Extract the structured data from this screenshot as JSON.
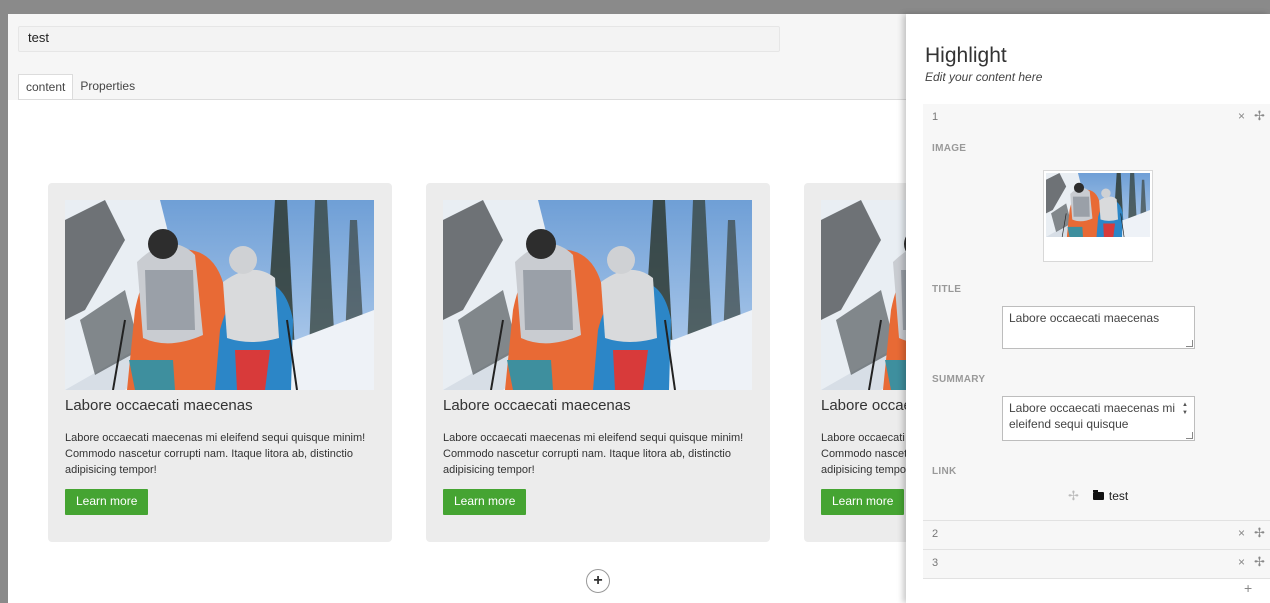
{
  "editor": {
    "name_value": "test",
    "tabs": [
      {
        "label": "content"
      },
      {
        "label": "Properties"
      }
    ]
  },
  "cards": [
    {
      "title": "Labore occaecati maecenas",
      "text": "Labore occaecati maecenas mi eleifend sequi quisque minim! Commodo nascetur corrupti nam. Itaque litora ab, distinctio adipisicing tempor!",
      "button": "Learn more"
    },
    {
      "title": "Labore occaecati maecenas",
      "text": "Labore occaecati maecenas mi eleifend sequi quisque minim! Commodo nascetur corrupti nam. Itaque litora ab, distinctio adipisicing tempor!",
      "button": "Learn more"
    },
    {
      "title": "Labore occaecati maecenas",
      "text": "Labore occaecati maecenas mi eleifend sequi quisque minim! Commodo nascetur corrupti nam. Itaque litora ab, distinctio adipisicing tempor!",
      "button": "Learn more"
    }
  ],
  "add_section_icon": "plus-circle-icon",
  "panel": {
    "title": "Highlight",
    "subtitle": "Edit your content here",
    "items": [
      {
        "number": "1"
      },
      {
        "number": "2"
      },
      {
        "number": "3"
      }
    ],
    "remove_glyph": "×",
    "move_glyph": "✢",
    "add_glyph": "+",
    "fields": {
      "image_label": "IMAGE",
      "title_label": "TITLE",
      "title_value": "Labore occaecati maecenas",
      "summary_label": "SUMMARY",
      "summary_value": "Labore occaecati maecenas mi eleifend sequi quisque",
      "link_label": "LINK",
      "link_value": "test"
    }
  },
  "colors": {
    "button_green": "#45a432",
    "frame_gray": "#8a8a8a",
    "card_bg": "#ececec"
  }
}
